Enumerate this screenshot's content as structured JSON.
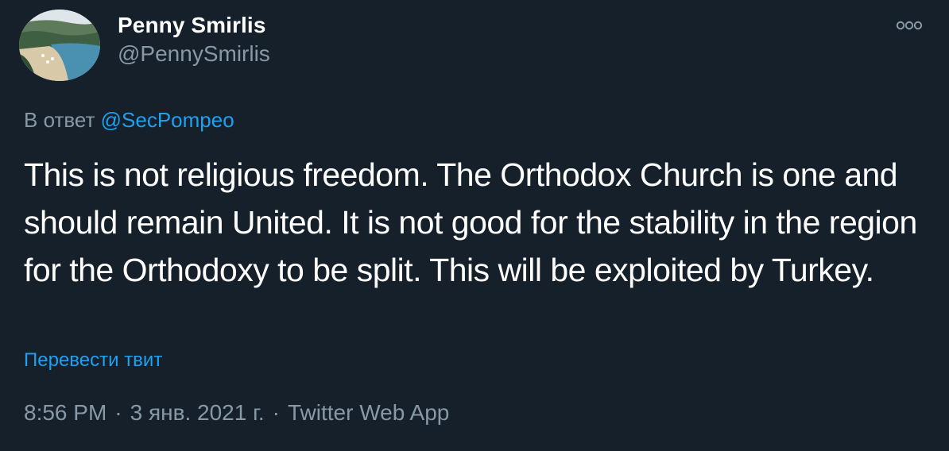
{
  "author": {
    "display_name": "Penny Smirlis",
    "handle": "@PennySmirlis"
  },
  "more_icon": "more-horizontal-icon",
  "reply": {
    "prefix": "В ответ",
    "mention": "@SecPompeo"
  },
  "tweet": {
    "text": "This is not religious freedom. The Orthodox Church is one and should remain United. It is not good for the stability in the region for the Orthodoxy to be split. This will be exploited by Turkey."
  },
  "translate_label": "Перевести твит",
  "meta": {
    "time": "8:56 PM",
    "date": "3 янв. 2021 г.",
    "separator": "·",
    "source": "Twitter Web App"
  },
  "colors": {
    "background": "#15202b",
    "text_primary": "#ffffff",
    "text_secondary": "#8899a6",
    "accent": "#1da1f2"
  }
}
